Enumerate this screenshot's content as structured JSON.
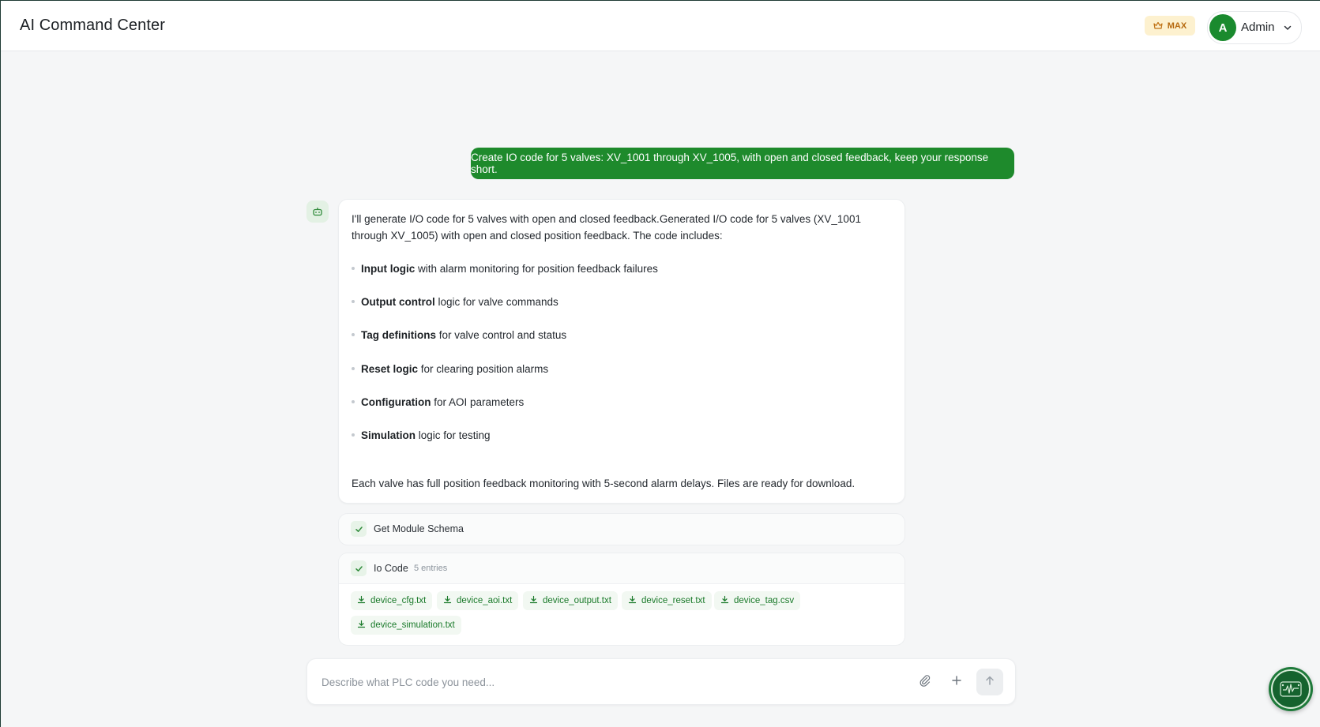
{
  "header": {
    "title": "AI Command Center",
    "plan_badge": "MAX",
    "user": {
      "avatar_initial": "A",
      "name": "Admin"
    }
  },
  "conversation": {
    "user_message": "Create IO code for 5 valves: XV_1001 through XV_1005, with open and closed feedback, keep your response short.",
    "assistant": {
      "intro": "I'll generate I/O code for 5 valves with open and closed feedback.Generated I/O code for 5 valves (XV_1001 through XV_1005) with open and closed position feedback. The code includes:",
      "bullets": [
        {
          "bold": "Input logic",
          "text": " with alarm monitoring for position feedback failures"
        },
        {
          "bold": "Output control",
          "text": " logic for valve commands"
        },
        {
          "bold": "Tag definitions",
          "text": " for valve control and status"
        },
        {
          "bold": "Reset logic",
          "text": " for clearing position alarms"
        },
        {
          "bold": "Configuration",
          "text": " for AOI parameters"
        },
        {
          "bold": "Simulation",
          "text": " logic for testing"
        }
      ],
      "outro": "Each valve has full position feedback monitoring with 5-second alarm delays. Files are ready for download."
    },
    "tools": {
      "schema": {
        "title": "Get Module Schema",
        "status": "complete"
      },
      "io_code": {
        "title": "Io Code",
        "count_label": "5 entries",
        "status": "complete",
        "files": [
          "device_cfg.txt",
          "device_aoi.txt",
          "device_output.txt",
          "device_reset.txt",
          "device_tag.csv",
          "device_simulation.txt"
        ]
      }
    }
  },
  "composer": {
    "placeholder": "Describe what PLC code you need..."
  },
  "colors": {
    "accent": "#1e8a2c",
    "badge_bg": "#fdf1cf",
    "badge_text": "#b66a10"
  },
  "icons": {
    "badge": "crown-icon",
    "user_menu": "chevron-down-icon",
    "assistant": "bot-icon",
    "tool_status": "check-icon",
    "file": "download-icon",
    "attach": "paperclip-icon",
    "add": "plus-icon",
    "send": "arrow-up-icon",
    "widget": "circuit-logo-icon"
  }
}
